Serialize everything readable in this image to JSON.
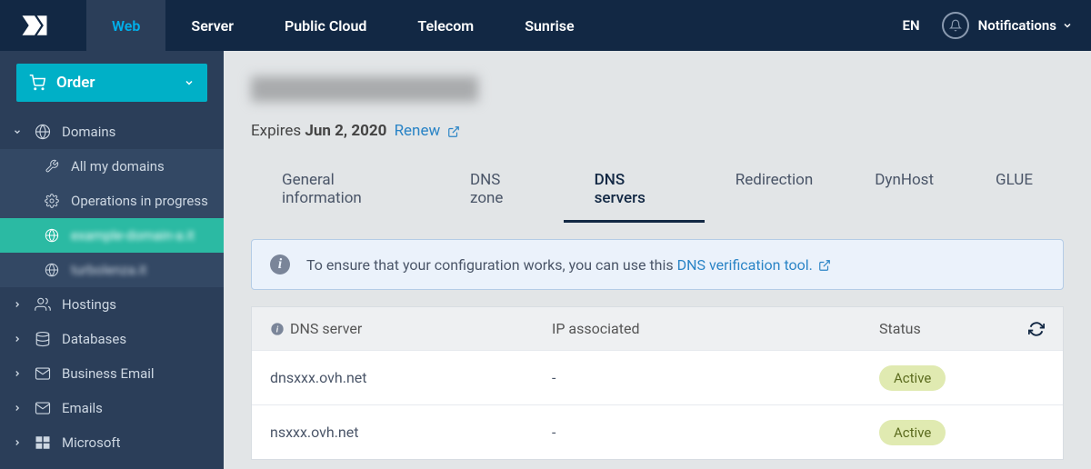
{
  "topnav": {
    "tabs": [
      "Web",
      "Server",
      "Public Cloud",
      "Telecom",
      "Sunrise"
    ],
    "active": "Web",
    "lang": "EN",
    "notifications": "Notifications"
  },
  "sidebar": {
    "order": "Order",
    "domains": {
      "label": "Domains",
      "items": [
        {
          "label": "All my domains",
          "blurred": false,
          "highlight": false
        },
        {
          "label": "Operations in progress",
          "blurred": false,
          "highlight": false
        },
        {
          "label": "example-domain-a.it",
          "blurred": true,
          "highlight": true
        },
        {
          "label": "turbolenza.it",
          "blurred": true,
          "highlight": false
        }
      ]
    },
    "sections": [
      "Hostings",
      "Databases",
      "Business Email",
      "Emails",
      "Microsoft"
    ]
  },
  "page": {
    "title_blurred": "example-domain.it",
    "expires_label": "Expires",
    "expires_date": "Jun 2, 2020",
    "renew": "Renew"
  },
  "tabs": {
    "items": [
      "General information",
      "DNS zone",
      "DNS servers",
      "Redirection",
      "DynHost",
      "GLUE"
    ],
    "active": "DNS servers"
  },
  "alert": {
    "text": "To ensure that your configuration works, you can use this ",
    "link": "DNS verification tool."
  },
  "table": {
    "headers": {
      "c1": "DNS server",
      "c2": "IP associated",
      "c3": "Status"
    },
    "rows": [
      {
        "server": "dnsxxx.ovh.net",
        "ip": "-",
        "status": "Active"
      },
      {
        "server": "nsxxx.ovh.net",
        "ip": "-",
        "status": "Active"
      }
    ]
  }
}
